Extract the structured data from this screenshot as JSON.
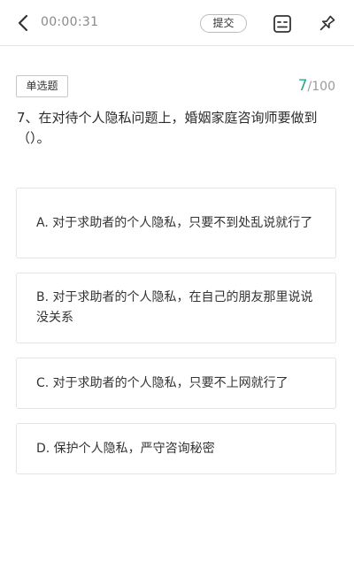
{
  "header": {
    "timer": "00:00:31",
    "submit_label": "提交"
  },
  "question": {
    "type_label": "单选题",
    "current": "7",
    "total": "/100",
    "text": "7、在对待个人隐私问题上，婚姻家庭咨询师要做到（）。"
  },
  "options": [
    {
      "text": "A. 对于求助者的个人隐私，只要不到处乱说就行了"
    },
    {
      "text": "B. 对于求助者的个人隐私，在自己的朋友那里说说没关系"
    },
    {
      "text": "C. 对于求助者的个人隐私，只要不上网就行了"
    },
    {
      "text": "D. 保护个人隐私，严守咨询秘密"
    }
  ],
  "colors": {
    "accent": "#2aa88a",
    "muted": "#9a9a9a",
    "border": "#e4e4e4"
  },
  "icons": [
    "back-arrow-icon",
    "answer-sheet-icon",
    "pin-icon"
  ]
}
